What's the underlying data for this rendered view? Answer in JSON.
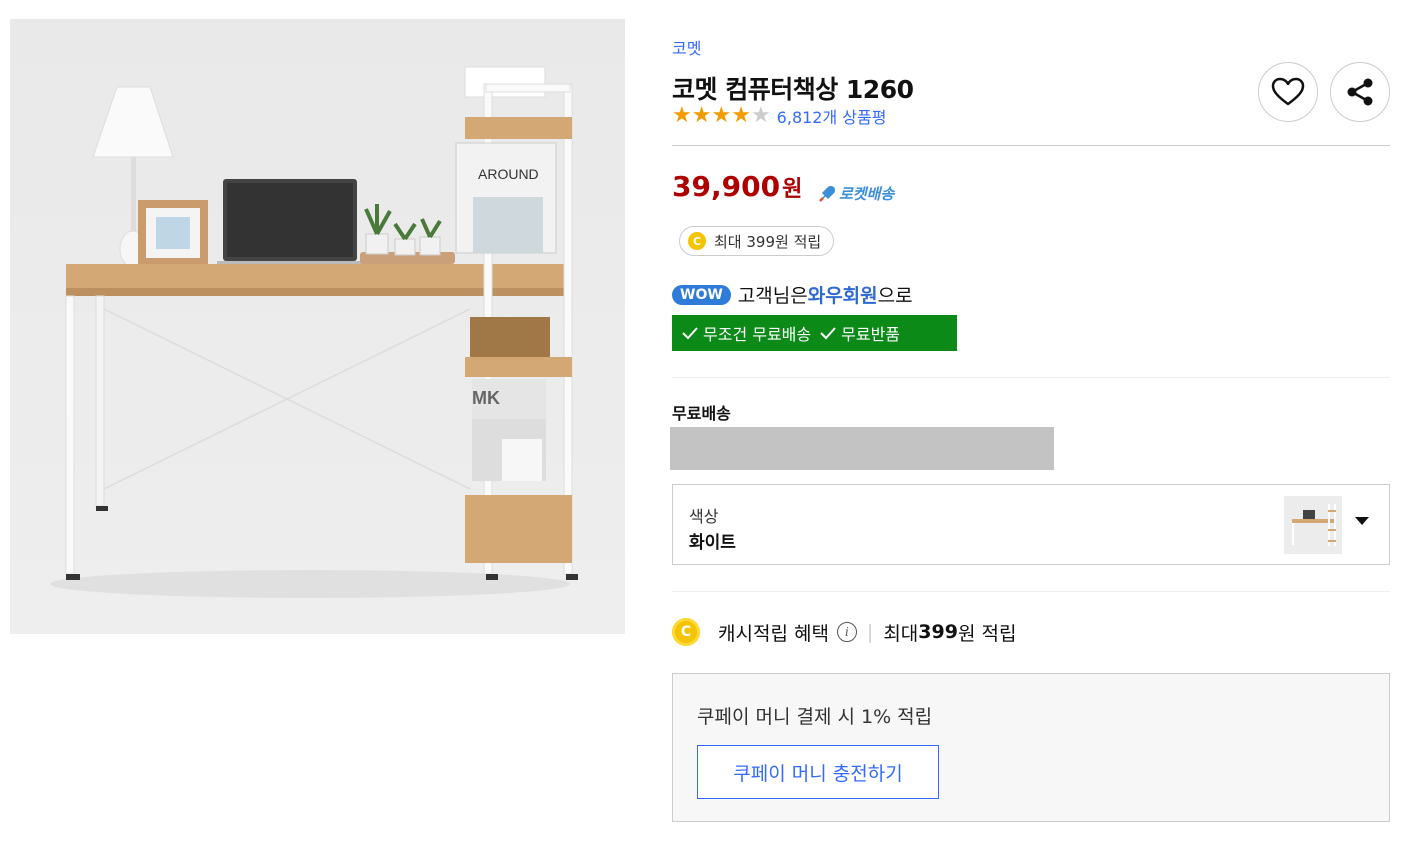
{
  "product": {
    "brand": "코멧",
    "title": "코멧 컴퓨터책상 1260",
    "rating": {
      "stars": 4,
      "max": 5,
      "review_count": "6,812개 상품평"
    },
    "price": {
      "amount": "39,900",
      "unit": "원"
    },
    "rocket_label": "로켓배송",
    "cash_pill": "최대 399원 적립",
    "image_text": {
      "book_cover": "AROUND",
      "magazine": "MK"
    }
  },
  "wow": {
    "badge": "WOW",
    "line_prefix": "고객님은 ",
    "line_strong": "와우회원",
    "line_suffix": "으로",
    "benefit_1": "무조건 무료배송",
    "benefit_2": "무료반품"
  },
  "shipping": {
    "label": "무료배송"
  },
  "option": {
    "label": "색상",
    "value": "화이트"
  },
  "cash_benefit": {
    "label": "캐시적립 혜택",
    "prefix": "최대 ",
    "amount": "399",
    "suffix": "원 적립"
  },
  "coupay": {
    "text": "쿠페이 머니 결제 시 1% 적립",
    "button": "쿠페이 머니 충전하기"
  },
  "icons": {
    "heart": "heart-icon",
    "share": "share-icon",
    "coin_letter": "C",
    "info": "i"
  },
  "colors": {
    "price": "#ae0000",
    "link": "#346aff",
    "wow_green": "#0b8a17",
    "star": "#f39c00"
  }
}
